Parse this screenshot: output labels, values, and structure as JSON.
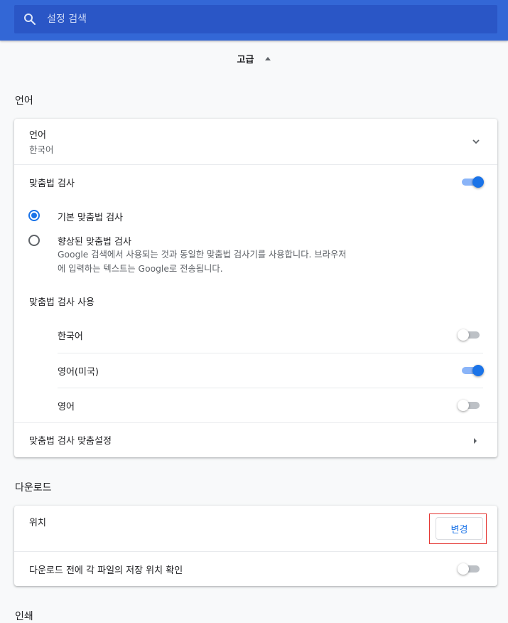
{
  "search": {
    "placeholder": "설정 검색"
  },
  "advanced": {
    "label": "고급"
  },
  "language_section": {
    "title": "언어",
    "language_row": {
      "label": "언어",
      "value": "한국어"
    },
    "spellcheck": {
      "label": "맞춤법 검사",
      "enabled": true
    },
    "basic_spellcheck": {
      "label": "기본 맞춤법 검사",
      "selected": true
    },
    "enhanced_spellcheck": {
      "label": "향상된 맞춤법 검사",
      "description_line1": "Google 검색에서 사용되는 것과 동일한 맞춤법 검사기를 사용합니다. 브라우저",
      "description_line2": "에 입력하는 텍스트는 Google로 전송됩니다.",
      "selected": false
    },
    "spellcheck_use": {
      "label": "맞춤법 검사 사용"
    },
    "languages": [
      {
        "label": "한국어",
        "enabled": false
      },
      {
        "label": "영어(미국)",
        "enabled": true
      },
      {
        "label": "영어",
        "enabled": false
      }
    ],
    "customize": {
      "label": "맞춤법 검사 맞춤설정"
    }
  },
  "download_section": {
    "title": "다운로드",
    "location": {
      "label": "위치",
      "button": "변경"
    },
    "ask_location": {
      "label": "다운로드 전에 각 파일의 저장 위치 확인",
      "enabled": false
    }
  },
  "print_section": {
    "title": "인쇄"
  },
  "colors": {
    "accent": "#1a73e8",
    "header": "#3367d6",
    "highlight_box": "#e53935"
  }
}
